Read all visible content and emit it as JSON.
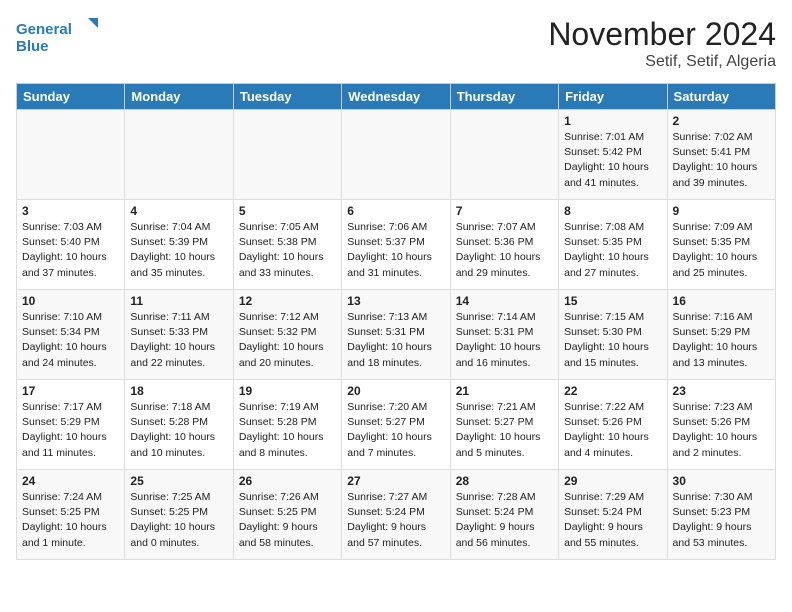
{
  "header": {
    "logo_line1": "General",
    "logo_line2": "Blue",
    "month": "November 2024",
    "location": "Setif, Setif, Algeria"
  },
  "days_of_week": [
    "Sunday",
    "Monday",
    "Tuesday",
    "Wednesday",
    "Thursday",
    "Friday",
    "Saturday"
  ],
  "weeks": [
    [
      {
        "day": "",
        "info": ""
      },
      {
        "day": "",
        "info": ""
      },
      {
        "day": "",
        "info": ""
      },
      {
        "day": "",
        "info": ""
      },
      {
        "day": "",
        "info": ""
      },
      {
        "day": "1",
        "info": "Sunrise: 7:01 AM\nSunset: 5:42 PM\nDaylight: 10 hours\nand 41 minutes."
      },
      {
        "day": "2",
        "info": "Sunrise: 7:02 AM\nSunset: 5:41 PM\nDaylight: 10 hours\nand 39 minutes."
      }
    ],
    [
      {
        "day": "3",
        "info": "Sunrise: 7:03 AM\nSunset: 5:40 PM\nDaylight: 10 hours\nand 37 minutes."
      },
      {
        "day": "4",
        "info": "Sunrise: 7:04 AM\nSunset: 5:39 PM\nDaylight: 10 hours\nand 35 minutes."
      },
      {
        "day": "5",
        "info": "Sunrise: 7:05 AM\nSunset: 5:38 PM\nDaylight: 10 hours\nand 33 minutes."
      },
      {
        "day": "6",
        "info": "Sunrise: 7:06 AM\nSunset: 5:37 PM\nDaylight: 10 hours\nand 31 minutes."
      },
      {
        "day": "7",
        "info": "Sunrise: 7:07 AM\nSunset: 5:36 PM\nDaylight: 10 hours\nand 29 minutes."
      },
      {
        "day": "8",
        "info": "Sunrise: 7:08 AM\nSunset: 5:35 PM\nDaylight: 10 hours\nand 27 minutes."
      },
      {
        "day": "9",
        "info": "Sunrise: 7:09 AM\nSunset: 5:35 PM\nDaylight: 10 hours\nand 25 minutes."
      }
    ],
    [
      {
        "day": "10",
        "info": "Sunrise: 7:10 AM\nSunset: 5:34 PM\nDaylight: 10 hours\nand 24 minutes."
      },
      {
        "day": "11",
        "info": "Sunrise: 7:11 AM\nSunset: 5:33 PM\nDaylight: 10 hours\nand 22 minutes."
      },
      {
        "day": "12",
        "info": "Sunrise: 7:12 AM\nSunset: 5:32 PM\nDaylight: 10 hours\nand 20 minutes."
      },
      {
        "day": "13",
        "info": "Sunrise: 7:13 AM\nSunset: 5:31 PM\nDaylight: 10 hours\nand 18 minutes."
      },
      {
        "day": "14",
        "info": "Sunrise: 7:14 AM\nSunset: 5:31 PM\nDaylight: 10 hours\nand 16 minutes."
      },
      {
        "day": "15",
        "info": "Sunrise: 7:15 AM\nSunset: 5:30 PM\nDaylight: 10 hours\nand 15 minutes."
      },
      {
        "day": "16",
        "info": "Sunrise: 7:16 AM\nSunset: 5:29 PM\nDaylight: 10 hours\nand 13 minutes."
      }
    ],
    [
      {
        "day": "17",
        "info": "Sunrise: 7:17 AM\nSunset: 5:29 PM\nDaylight: 10 hours\nand 11 minutes."
      },
      {
        "day": "18",
        "info": "Sunrise: 7:18 AM\nSunset: 5:28 PM\nDaylight: 10 hours\nand 10 minutes."
      },
      {
        "day": "19",
        "info": "Sunrise: 7:19 AM\nSunset: 5:28 PM\nDaylight: 10 hours\nand 8 minutes."
      },
      {
        "day": "20",
        "info": "Sunrise: 7:20 AM\nSunset: 5:27 PM\nDaylight: 10 hours\nand 7 minutes."
      },
      {
        "day": "21",
        "info": "Sunrise: 7:21 AM\nSunset: 5:27 PM\nDaylight: 10 hours\nand 5 minutes."
      },
      {
        "day": "22",
        "info": "Sunrise: 7:22 AM\nSunset: 5:26 PM\nDaylight: 10 hours\nand 4 minutes."
      },
      {
        "day": "23",
        "info": "Sunrise: 7:23 AM\nSunset: 5:26 PM\nDaylight: 10 hours\nand 2 minutes."
      }
    ],
    [
      {
        "day": "24",
        "info": "Sunrise: 7:24 AM\nSunset: 5:25 PM\nDaylight: 10 hours\nand 1 minute."
      },
      {
        "day": "25",
        "info": "Sunrise: 7:25 AM\nSunset: 5:25 PM\nDaylight: 10 hours\nand 0 minutes."
      },
      {
        "day": "26",
        "info": "Sunrise: 7:26 AM\nSunset: 5:25 PM\nDaylight: 9 hours\nand 58 minutes."
      },
      {
        "day": "27",
        "info": "Sunrise: 7:27 AM\nSunset: 5:24 PM\nDaylight: 9 hours\nand 57 minutes."
      },
      {
        "day": "28",
        "info": "Sunrise: 7:28 AM\nSunset: 5:24 PM\nDaylight: 9 hours\nand 56 minutes."
      },
      {
        "day": "29",
        "info": "Sunrise: 7:29 AM\nSunset: 5:24 PM\nDaylight: 9 hours\nand 55 minutes."
      },
      {
        "day": "30",
        "info": "Sunrise: 7:30 AM\nSunset: 5:23 PM\nDaylight: 9 hours\nand 53 minutes."
      }
    ]
  ]
}
